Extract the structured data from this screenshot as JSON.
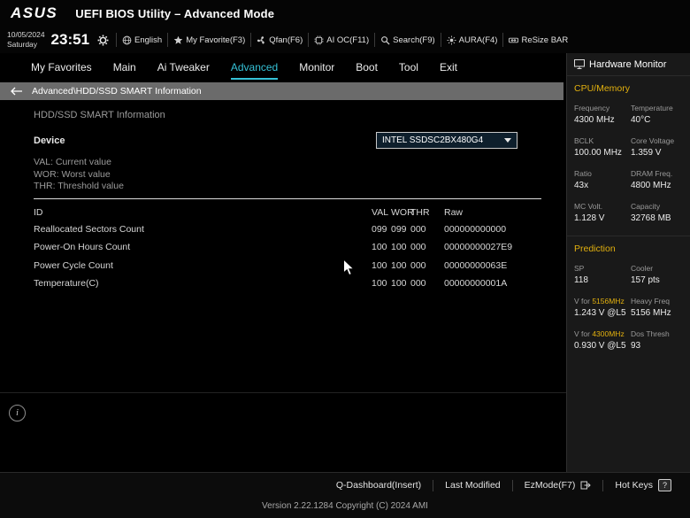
{
  "header": {
    "brand": "ASUS",
    "title": "UEFI BIOS Utility – Advanced Mode",
    "date": "10/05/2024",
    "day": "Saturday",
    "time": "23:51",
    "toolbar": [
      {
        "icon": "language-globe-icon",
        "label": "English"
      },
      {
        "icon": "my-favorite-icon",
        "label": "My Favorite(F3)"
      },
      {
        "icon": "qfan-icon",
        "label": "Qfan(F6)"
      },
      {
        "icon": "ai-oc-icon",
        "label": "AI OC(F11)"
      },
      {
        "icon": "search-icon",
        "label": "Search(F9)"
      },
      {
        "icon": "aura-icon",
        "label": "AURA(F4)"
      },
      {
        "icon": "resize-bar-icon",
        "label": "ReSize BAR"
      }
    ]
  },
  "nav": {
    "tabs": [
      {
        "label": "My Favorites",
        "active": false
      },
      {
        "label": "Main",
        "active": false
      },
      {
        "label": "Ai Tweaker",
        "active": false
      },
      {
        "label": "Advanced",
        "active": true
      },
      {
        "label": "Monitor",
        "active": false
      },
      {
        "label": "Boot",
        "active": false
      },
      {
        "label": "Tool",
        "active": false
      },
      {
        "label": "Exit",
        "active": false
      }
    ]
  },
  "breadcrumb": {
    "path": "Advanced\\HDD/SSD SMART Information"
  },
  "main": {
    "section_title": "HDD/SSD SMART Information",
    "device_label": "Device",
    "device_value": "INTEL SSDSC2BX480G4",
    "legend": [
      "VAL:  Current value",
      "WOR: Worst value",
      "THR:  Threshold value"
    ],
    "table": {
      "headers": [
        "ID",
        "VAL",
        "WOR",
        "THR",
        "Raw"
      ],
      "rows": [
        {
          "id": "Reallocated Sectors Count",
          "val": "099",
          "wor": "099",
          "thr": "000",
          "raw": "000000000000"
        },
        {
          "id": "Power-On Hours Count",
          "val": "100",
          "wor": "100",
          "thr": "000",
          "raw": "00000000027E9"
        },
        {
          "id": "Power Cycle Count",
          "val": "100",
          "wor": "100",
          "thr": "000",
          "raw": "00000000063E"
        },
        {
          "id": "Temperature(C)",
          "val": "100",
          "wor": "100",
          "thr": "000",
          "raw": "00000000001A"
        }
      ]
    },
    "info_glyph": "i"
  },
  "sidebar": {
    "title": "Hardware Monitor",
    "cpu_memory": {
      "title": "CPU/Memory",
      "stats": [
        {
          "label": "Frequency",
          "value": "4300 MHz"
        },
        {
          "label": "Temperature",
          "value": "40°C"
        },
        {
          "label": "BCLK",
          "value": "100.00 MHz"
        },
        {
          "label": "Core Voltage",
          "value": "1.359 V"
        },
        {
          "label": "Ratio",
          "value": "43x"
        },
        {
          "label": "DRAM Freq.",
          "value": "4800 MHz"
        },
        {
          "label": "MC Volt.",
          "value": "1.128 V"
        },
        {
          "label": "Capacity",
          "value": "32768 MB"
        }
      ]
    },
    "prediction": {
      "title": "Prediction",
      "stats": [
        {
          "label": "SP",
          "value": "118"
        },
        {
          "label": "Cooler",
          "value": "157 pts"
        },
        {
          "label_prefix": "V for ",
          "label_accent": "5156MHz",
          "value": "1.243 V @L5"
        },
        {
          "label": "Heavy Freq",
          "value": "5156 MHz"
        },
        {
          "label_prefix": "V for ",
          "label_accent": "4300MHz",
          "value": "0.930 V @L5"
        },
        {
          "label": "Dos Thresh",
          "value": "93"
        }
      ]
    }
  },
  "footer": {
    "qdashboard": "Q-Dashboard(Insert)",
    "last_modified": "Last Modified",
    "ezmode": "EzMode(F7)",
    "hotkeys": "Hot Keys",
    "help_badge": "?",
    "version": "Version 2.22.1284 Copyright (C) 2024 AMI"
  },
  "colors": {
    "accent_cyan": "#35c1d6",
    "accent_yellow": "#e2b00e",
    "breadcrumb_gray": "#6b6b6b"
  }
}
